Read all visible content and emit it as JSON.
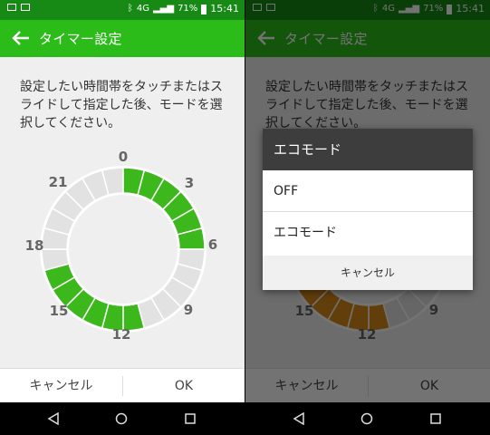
{
  "status": {
    "battery_percent": "71%",
    "time": "15:41",
    "signal_text": "4G"
  },
  "toolbar": {
    "title": "タイマー設定"
  },
  "instruction": {
    "line1": "設定したい時間帯をタッチまたはス",
    "line2": "ライドして指定した後、モードを選",
    "line3": "択してください。"
  },
  "dial": {
    "labels": [
      "0",
      "3",
      "6",
      "9",
      "12",
      "15",
      "18",
      "21"
    ]
  },
  "buttons": {
    "cancel": "キャンセル",
    "ok": "OK"
  },
  "dialog": {
    "title": "エコモード",
    "options": [
      "OFF",
      "エコモード"
    ],
    "cancel": "キャンセル"
  },
  "colors": {
    "status_green": "#168a14",
    "toolbar_green": "#2cbc1a",
    "slot_green": "#3cb81d",
    "slot_orange": "#d98a1a",
    "slot_gray": "#e2e2e2"
  },
  "schedule": {
    "left": [
      "g",
      "g",
      "g",
      "g",
      "g",
      "g",
      "w",
      "w",
      "w",
      "w",
      "w",
      "g",
      "g",
      "g",
      "g",
      "g",
      "g",
      "w",
      "w",
      "w",
      "w",
      "w",
      "w",
      "w"
    ],
    "right": [
      "g",
      "g",
      "g",
      "g",
      "g",
      "g",
      "w",
      "w",
      "w",
      "w",
      "w",
      "o",
      "o",
      "o",
      "o",
      "o",
      "o",
      "w",
      "w",
      "w",
      "w",
      "w",
      "w",
      "w"
    ]
  }
}
